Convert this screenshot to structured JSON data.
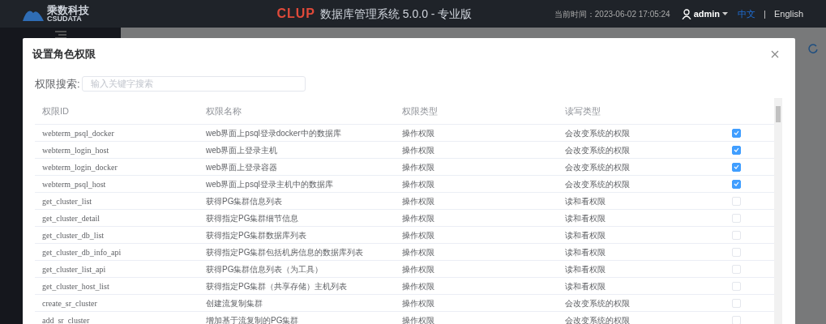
{
  "header": {
    "logo_cn": "乘数科技",
    "logo_en": "CSUDATA",
    "product_logo": "CLUP",
    "product_title": "数据库管理系统 5.0.0 - 专业版",
    "time_label": "当前时间：2023-06-02 17:05:24",
    "user": "admin",
    "language_separator": "|",
    "languages": [
      {
        "label": "中文",
        "selected": true
      },
      {
        "label": "English",
        "selected": false
      }
    ]
  },
  "dialog": {
    "title": "设置角色权限",
    "search": {
      "label": "权限搜索:",
      "placeholder": "输入关键字搜索"
    },
    "table": {
      "columns": [
        "权限ID",
        "权限名称",
        "权限类型",
        "读写类型"
      ],
      "rows": [
        {
          "id": "webterm_psql_docker",
          "name": "web界面上psql登录docker中的数据库",
          "type": "操作权限",
          "rw": "会改变系统的权限",
          "checked": true
        },
        {
          "id": "webterm_login_host",
          "name": "web界面上登录主机",
          "type": "操作权限",
          "rw": "会改变系统的权限",
          "checked": true
        },
        {
          "id": "webterm_login_docker",
          "name": "web界面上登录容器",
          "type": "操作权限",
          "rw": "会改变系统的权限",
          "checked": true
        },
        {
          "id": "webterm_psql_host",
          "name": "web界面上psql登录主机中的数据库",
          "type": "操作权限",
          "rw": "会改变系统的权限",
          "checked": true
        },
        {
          "id": "get_cluster_list",
          "name": "获得PG集群信息列表",
          "type": "操作权限",
          "rw": "读和看权限",
          "checked": false
        },
        {
          "id": "get_cluster_detail",
          "name": "获得指定PG集群细节信息",
          "type": "操作权限",
          "rw": "读和看权限",
          "checked": false
        },
        {
          "id": "get_cluster_db_list",
          "name": "获得指定PG集群数据库列表",
          "type": "操作权限",
          "rw": "读和看权限",
          "checked": false
        },
        {
          "id": "get_cluster_db_info_api",
          "name": "获得指定PG集群包括机房信息的数据库列表",
          "type": "操作权限",
          "rw": "读和看权限",
          "checked": false
        },
        {
          "id": "get_cluster_list_api",
          "name": "获得PG集群信息列表（为工具）",
          "type": "操作权限",
          "rw": "读和看权限",
          "checked": false
        },
        {
          "id": "get_cluster_host_list",
          "name": "获得指定PG集群（共享存储）主机列表",
          "type": "操作权限",
          "rw": "读和看权限",
          "checked": false
        },
        {
          "id": "create_sr_cluster",
          "name": "创建流复制集群",
          "type": "操作权限",
          "rw": "会改变系统的权限",
          "checked": false
        },
        {
          "id": "add_sr_cluster",
          "name": "增加基于流复制的PG集群",
          "type": "操作权限",
          "rw": "会改变系统的权限",
          "checked": false
        }
      ]
    }
  }
}
